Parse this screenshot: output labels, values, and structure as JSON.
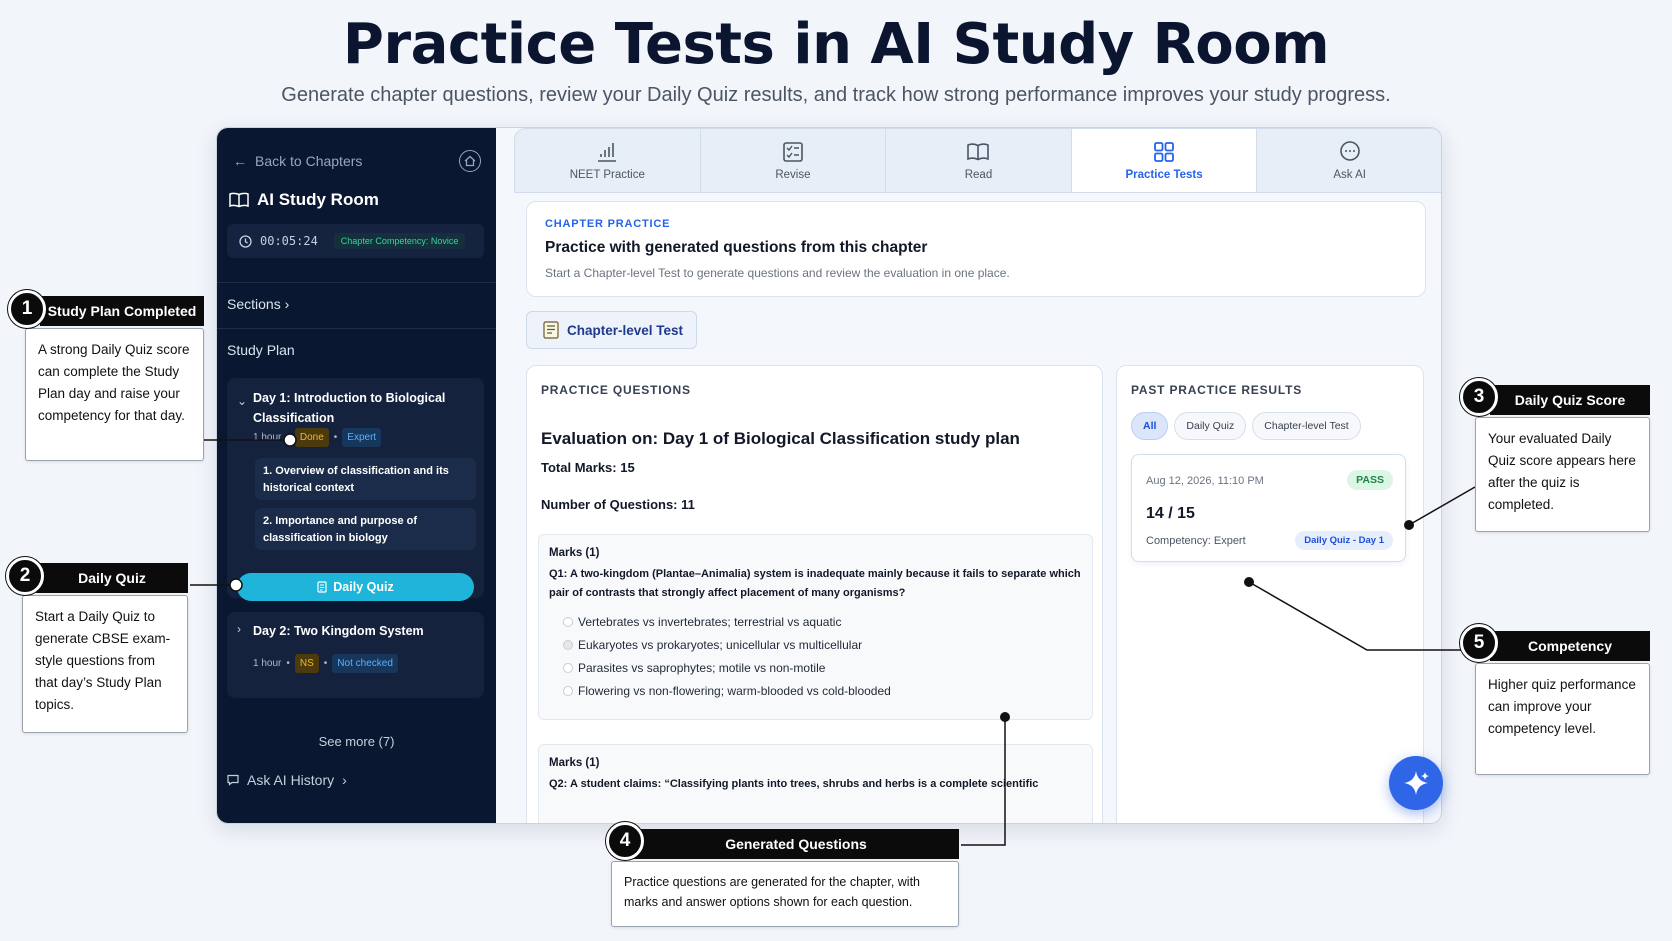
{
  "hero": {
    "title": "Practice Tests in AI Study Room",
    "subtitle": "Generate chapter questions, review your Daily Quiz results, and track how strong performance improves your study progress."
  },
  "sidebar": {
    "back": "Back to Chapters",
    "title": "AI Study Room",
    "timer": "00:05:24",
    "competency_badge": "Chapter Competency: Novice",
    "sections": "Sections",
    "study_plan": "Study Plan",
    "day1": {
      "title": "Day 1: Introduction to Biological Classification",
      "duration": "1 hour",
      "status": "Done",
      "level": "Expert",
      "topics": [
        "1. Overview of classification and its historical context",
        "2. Importance and purpose of classification in biology"
      ],
      "quiz_button": "Daily Quiz"
    },
    "day2": {
      "title": "Day 2: Two Kingdom System",
      "duration": "1 hour",
      "status": "NS",
      "level": "Not checked"
    },
    "see_more": "See more (7)",
    "ask_history": "Ask AI History"
  },
  "tabs": [
    {
      "label": "NEET Practice",
      "icon": "bar-chart-icon"
    },
    {
      "label": "Revise",
      "icon": "checklist-icon"
    },
    {
      "label": "Read",
      "icon": "book-icon"
    },
    {
      "label": "Practice Tests",
      "icon": "grid-icon",
      "active": true
    },
    {
      "label": "Ask AI",
      "icon": "chat-icon"
    }
  ],
  "chapter_practice": {
    "label": "CHAPTER PRACTICE",
    "title": "Practice with generated questions from this chapter",
    "subtitle": "Start a Chapter-level Test to generate questions and review the evaluation in one place.",
    "button": "Chapter-level Test"
  },
  "practice_questions": {
    "label": "PRACTICE QUESTIONS",
    "eval_title": "Evaluation on: Day 1 of Biological Classification study plan",
    "total_marks": "Total Marks: 15",
    "num_questions": "Number of Questions: 11",
    "q1": {
      "marks": "Marks (1)",
      "text": "Q1: A two-kingdom (Plantae–Animalia) system is inadequate mainly because it fails to separate which pair of contrasts that strongly affect placement of many organisms?",
      "options": [
        "Vertebrates vs invertebrates; terrestrial vs aquatic",
        "Eukaryotes vs prokaryotes; unicellular vs multicellular",
        "Parasites vs saprophytes; motile vs non-motile",
        "Flowering vs non-flowering; warm-blooded vs cold-blooded"
      ]
    },
    "q2": {
      "marks": "Marks (1)",
      "text": "Q2: A student claims: “Classifying plants into trees, shrubs and herbs is a complete scientific"
    }
  },
  "past_results": {
    "label": "PAST PRACTICE RESULTS",
    "filters": [
      "All",
      "Daily Quiz",
      "Chapter-level Test"
    ],
    "result": {
      "date": "Aug 12, 2026, 11:10 PM",
      "status": "PASS",
      "score": "14 / 15",
      "competency": "Competency: Expert",
      "badge": "Daily Quiz - Day 1"
    }
  },
  "callouts": {
    "c1": {
      "num": "1",
      "title": "Study Plan Completed",
      "body": "A strong Daily Quiz score can complete the Study Plan day and raise your competency for that day."
    },
    "c2": {
      "num": "2",
      "title": "Daily Quiz",
      "body": "Start a Daily Quiz to generate CBSE exam-style questions from that day’s Study Plan topics."
    },
    "c3": {
      "num": "3",
      "title": "Daily Quiz Score",
      "body": "Your evaluated Daily Quiz score appears here after the quiz is completed."
    },
    "c4": {
      "num": "4",
      "title": "Generated Questions",
      "body": "Practice questions are generated for the chapter, with marks and answer options shown for each question."
    },
    "c5": {
      "num": "5",
      "title": "Competency",
      "body": "Higher quiz performance can improve your competency level."
    }
  },
  "colors": {
    "accent": "#2563eb",
    "sidebar_bg": "#0a1730",
    "quiz_button": "#1fb4d9",
    "pass": "#168a45"
  }
}
